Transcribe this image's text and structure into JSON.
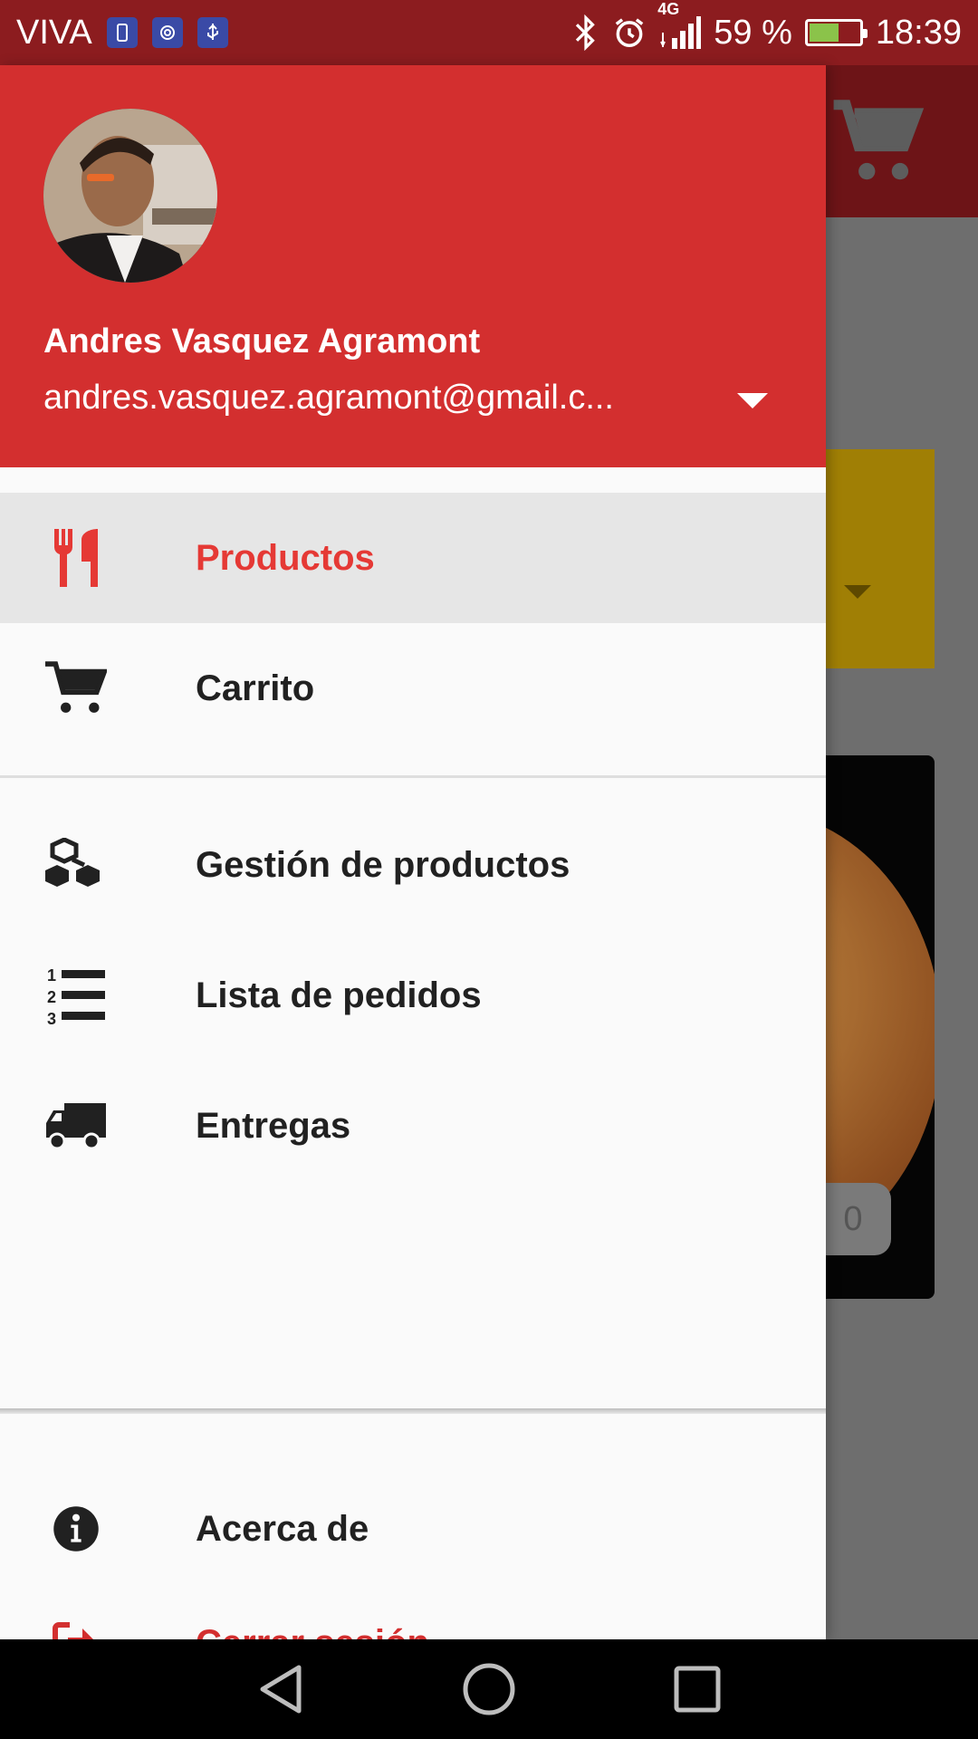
{
  "status_bar": {
    "carrier": "VIVA",
    "network": "4G",
    "battery_text": "59 %",
    "battery_level": 0.59,
    "time": "18:39",
    "bar_color": "#8c1c1f"
  },
  "drawer": {
    "header_color": "#d32f2f",
    "user": {
      "name": "Andres Vasquez Agramont",
      "email": "andres.vasquez.agramont@gmail.c..."
    },
    "menu_primary": [
      {
        "label": "Productos",
        "icon": "utensils-icon",
        "active": true
      },
      {
        "label": "Carrito",
        "icon": "cart-icon",
        "active": false
      }
    ],
    "menu_management": [
      {
        "label": "Gestión de productos",
        "icon": "cubes-icon"
      },
      {
        "label": "Lista de pedidos",
        "icon": "numbered-list-icon"
      },
      {
        "label": "Entregas",
        "icon": "truck-icon"
      }
    ],
    "menu_footer": [
      {
        "label": "Acerca de",
        "icon": "info-icon"
      },
      {
        "label": "Cerrar sesión",
        "icon": "sign-out-icon"
      }
    ],
    "accent_color": "#e53935"
  },
  "background": {
    "price_fragment": "0"
  }
}
